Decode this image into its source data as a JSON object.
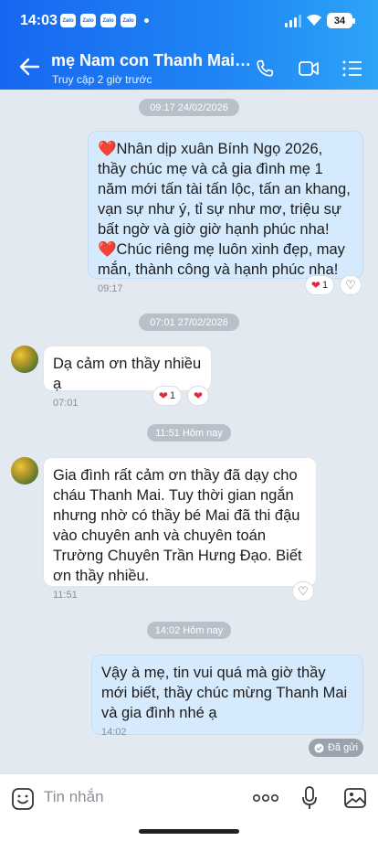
{
  "status": {
    "time": "14:03",
    "notif_apps": [
      "Zalo",
      "Zalo",
      "Zalo",
      "Zalo"
    ],
    "battery": "34"
  },
  "header": {
    "title": "mẹ Nam con Thanh Mai…",
    "subtitle": "Truy cập 2 giờ trước"
  },
  "colors": {
    "header_gradient_start": "#1767f0",
    "header_gradient_end": "#2ea3f7",
    "chat_background": "#e2e9f1",
    "outgoing_bubble": "#d5eafd",
    "incoming_bubble": "#ffffff",
    "heart": "#e0263c"
  },
  "separators": [
    "09:17 24/02/2026",
    "07:01 27/02/2026",
    "11:51 Hôm nay",
    "14:02 Hôm nay"
  ],
  "messages": [
    {
      "direction": "out",
      "text": "❤️Nhân dịp xuân Bính Ngọ 2026, thầy chúc mẹ và cả gia đình mẹ 1 năm mới tấn tài tấn lộc, tấn an khang, vạn sự như ý, tỉ sự như mơ, triệu sự bất ngờ và giờ giờ hạnh phúc nha!\n❤️Chúc riêng mẹ luôn xinh đẹp, may mắn, thành công và hạnh phúc nha!",
      "time": "09:17",
      "reaction_count": "1"
    },
    {
      "direction": "in",
      "text": "Dạ cảm ơn thầy nhiều ạ",
      "time": "07:01",
      "reaction_count": "1"
    },
    {
      "direction": "in",
      "text": "Gia đình rất cảm ơn thầy đã dạy cho cháu Thanh Mai. Tuy thời gian ngắn nhưng nhờ có thầy bé Mai đã thi đậu vào chuyên anh và chuyên toán Trường Chuyên Trần Hưng Đạo. Biết ơn thầy nhiều.",
      "time": "11:51"
    },
    {
      "direction": "out",
      "text": "Vậy à mẹ, tin vui quá mà giờ thầy mới biết, thầy chúc mừng Thanh Mai và gia đình nhé ạ",
      "time": "14:02"
    }
  ],
  "sent_status": "Đã gửi",
  "input": {
    "placeholder": "Tin nhắn"
  },
  "icons": [
    "back-arrow-icon",
    "phone-icon",
    "video-call-icon",
    "menu-icon",
    "emoji-icon",
    "more-icon",
    "mic-icon",
    "image-icon",
    "heart-icon",
    "heart-outline-icon",
    "check-icon"
  ]
}
